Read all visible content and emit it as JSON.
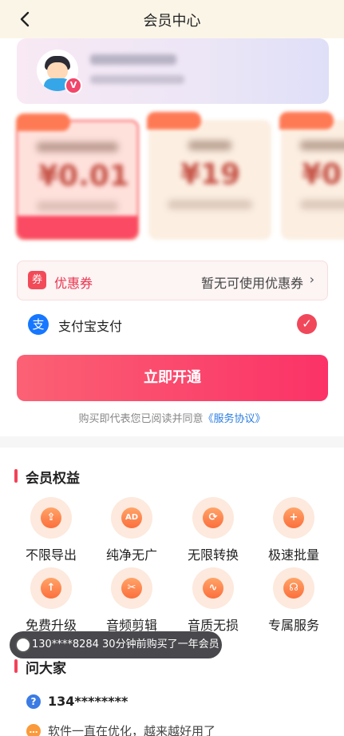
{
  "header": {
    "title": "会员中心",
    "back_icon": "chevron-left-icon"
  },
  "user": {
    "vip_badge": "V"
  },
  "coupon": {
    "icon_text": "券",
    "label": "优惠券",
    "status": "暂无可使用优惠券",
    "arrow": "›"
  },
  "payment": {
    "icon_text": "支",
    "label": "支付宝支付",
    "check": "✓"
  },
  "buy_button": {
    "label": "立即开通"
  },
  "agreement": {
    "text": "购买即代表您已阅读并同意",
    "link": "《服务协议》"
  },
  "benefits": {
    "title": "会员权益",
    "items": [
      {
        "label": "不限导出",
        "glyph": "⇪",
        "icon": "export-icon"
      },
      {
        "label": "纯净无广",
        "glyph": "AD",
        "icon": "no-ads-icon"
      },
      {
        "label": "无限转换",
        "glyph": "⟳",
        "icon": "convert-icon"
      },
      {
        "label": "极速批量",
        "glyph": "+",
        "icon": "batch-icon"
      },
      {
        "label": "免费升级",
        "glyph": "↑",
        "icon": "upgrade-icon"
      },
      {
        "label": "音频剪辑",
        "glyph": "✂",
        "icon": "scissors-icon"
      },
      {
        "label": "音质无损",
        "glyph": "∿",
        "icon": "waveform-icon"
      },
      {
        "label": "专属服务",
        "glyph": "☊",
        "icon": "headset-icon"
      }
    ]
  },
  "toast": {
    "text": "130****8284 30分钟前购买了一年会员"
  },
  "qa": {
    "title": "问大家",
    "question_icon": "?",
    "user": "134********",
    "answer_icon": "…",
    "answer": "软件一直在优化，越来越好用了"
  },
  "colors": {
    "accent": "#f2435a",
    "brand_gradient_start": "#fb6174",
    "brand_gradient_end": "#fb3267",
    "link": "#2a7de2"
  }
}
